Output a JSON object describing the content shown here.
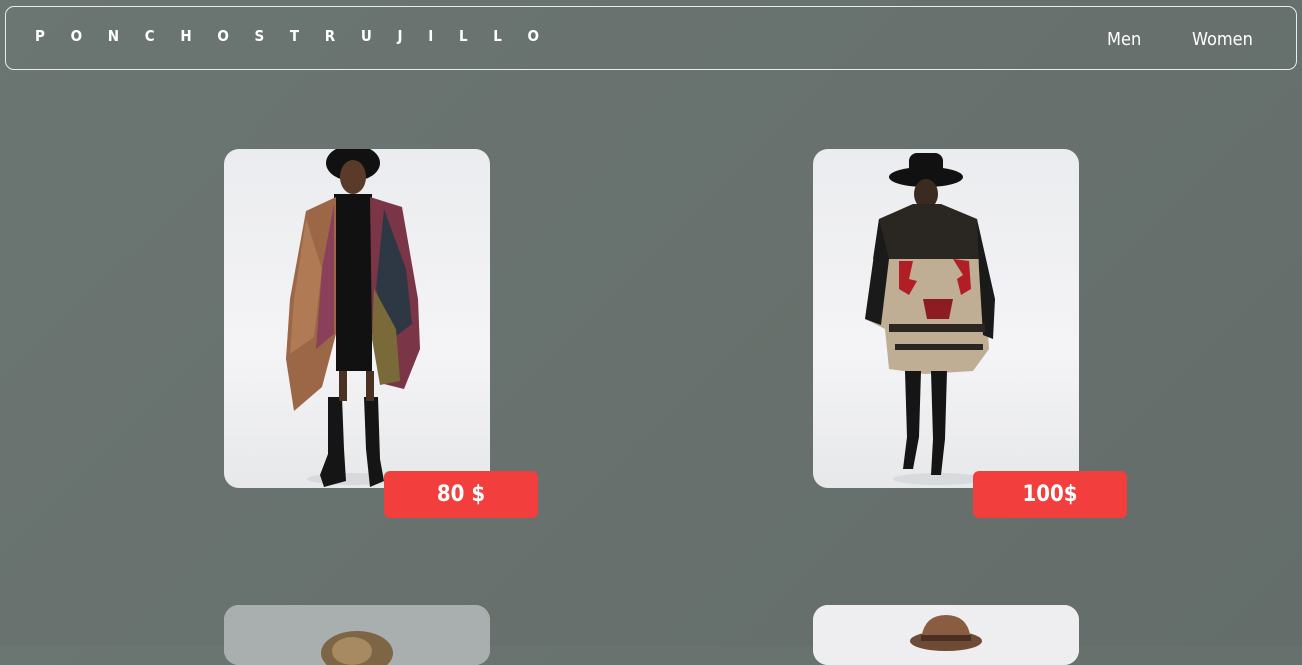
{
  "header": {
    "brand": "P O N C H O S   T R U J I L L O",
    "nav": [
      {
        "label": "Men"
      },
      {
        "label": "Women"
      }
    ]
  },
  "products": [
    {
      "price": "80 $",
      "image_desc": "man in multicolor wool poncho and black hat"
    },
    {
      "price": "100$",
      "image_desc": "man in black and beige aztec pattern poncho with wide brim hat"
    },
    {
      "price": "",
      "image_desc": "partial product photo"
    },
    {
      "price": "",
      "image_desc": "partial product photo with brown hat"
    }
  ],
  "colors": {
    "background": "#687170",
    "price_tag": "#f23f3e",
    "text": "#ffffff"
  }
}
